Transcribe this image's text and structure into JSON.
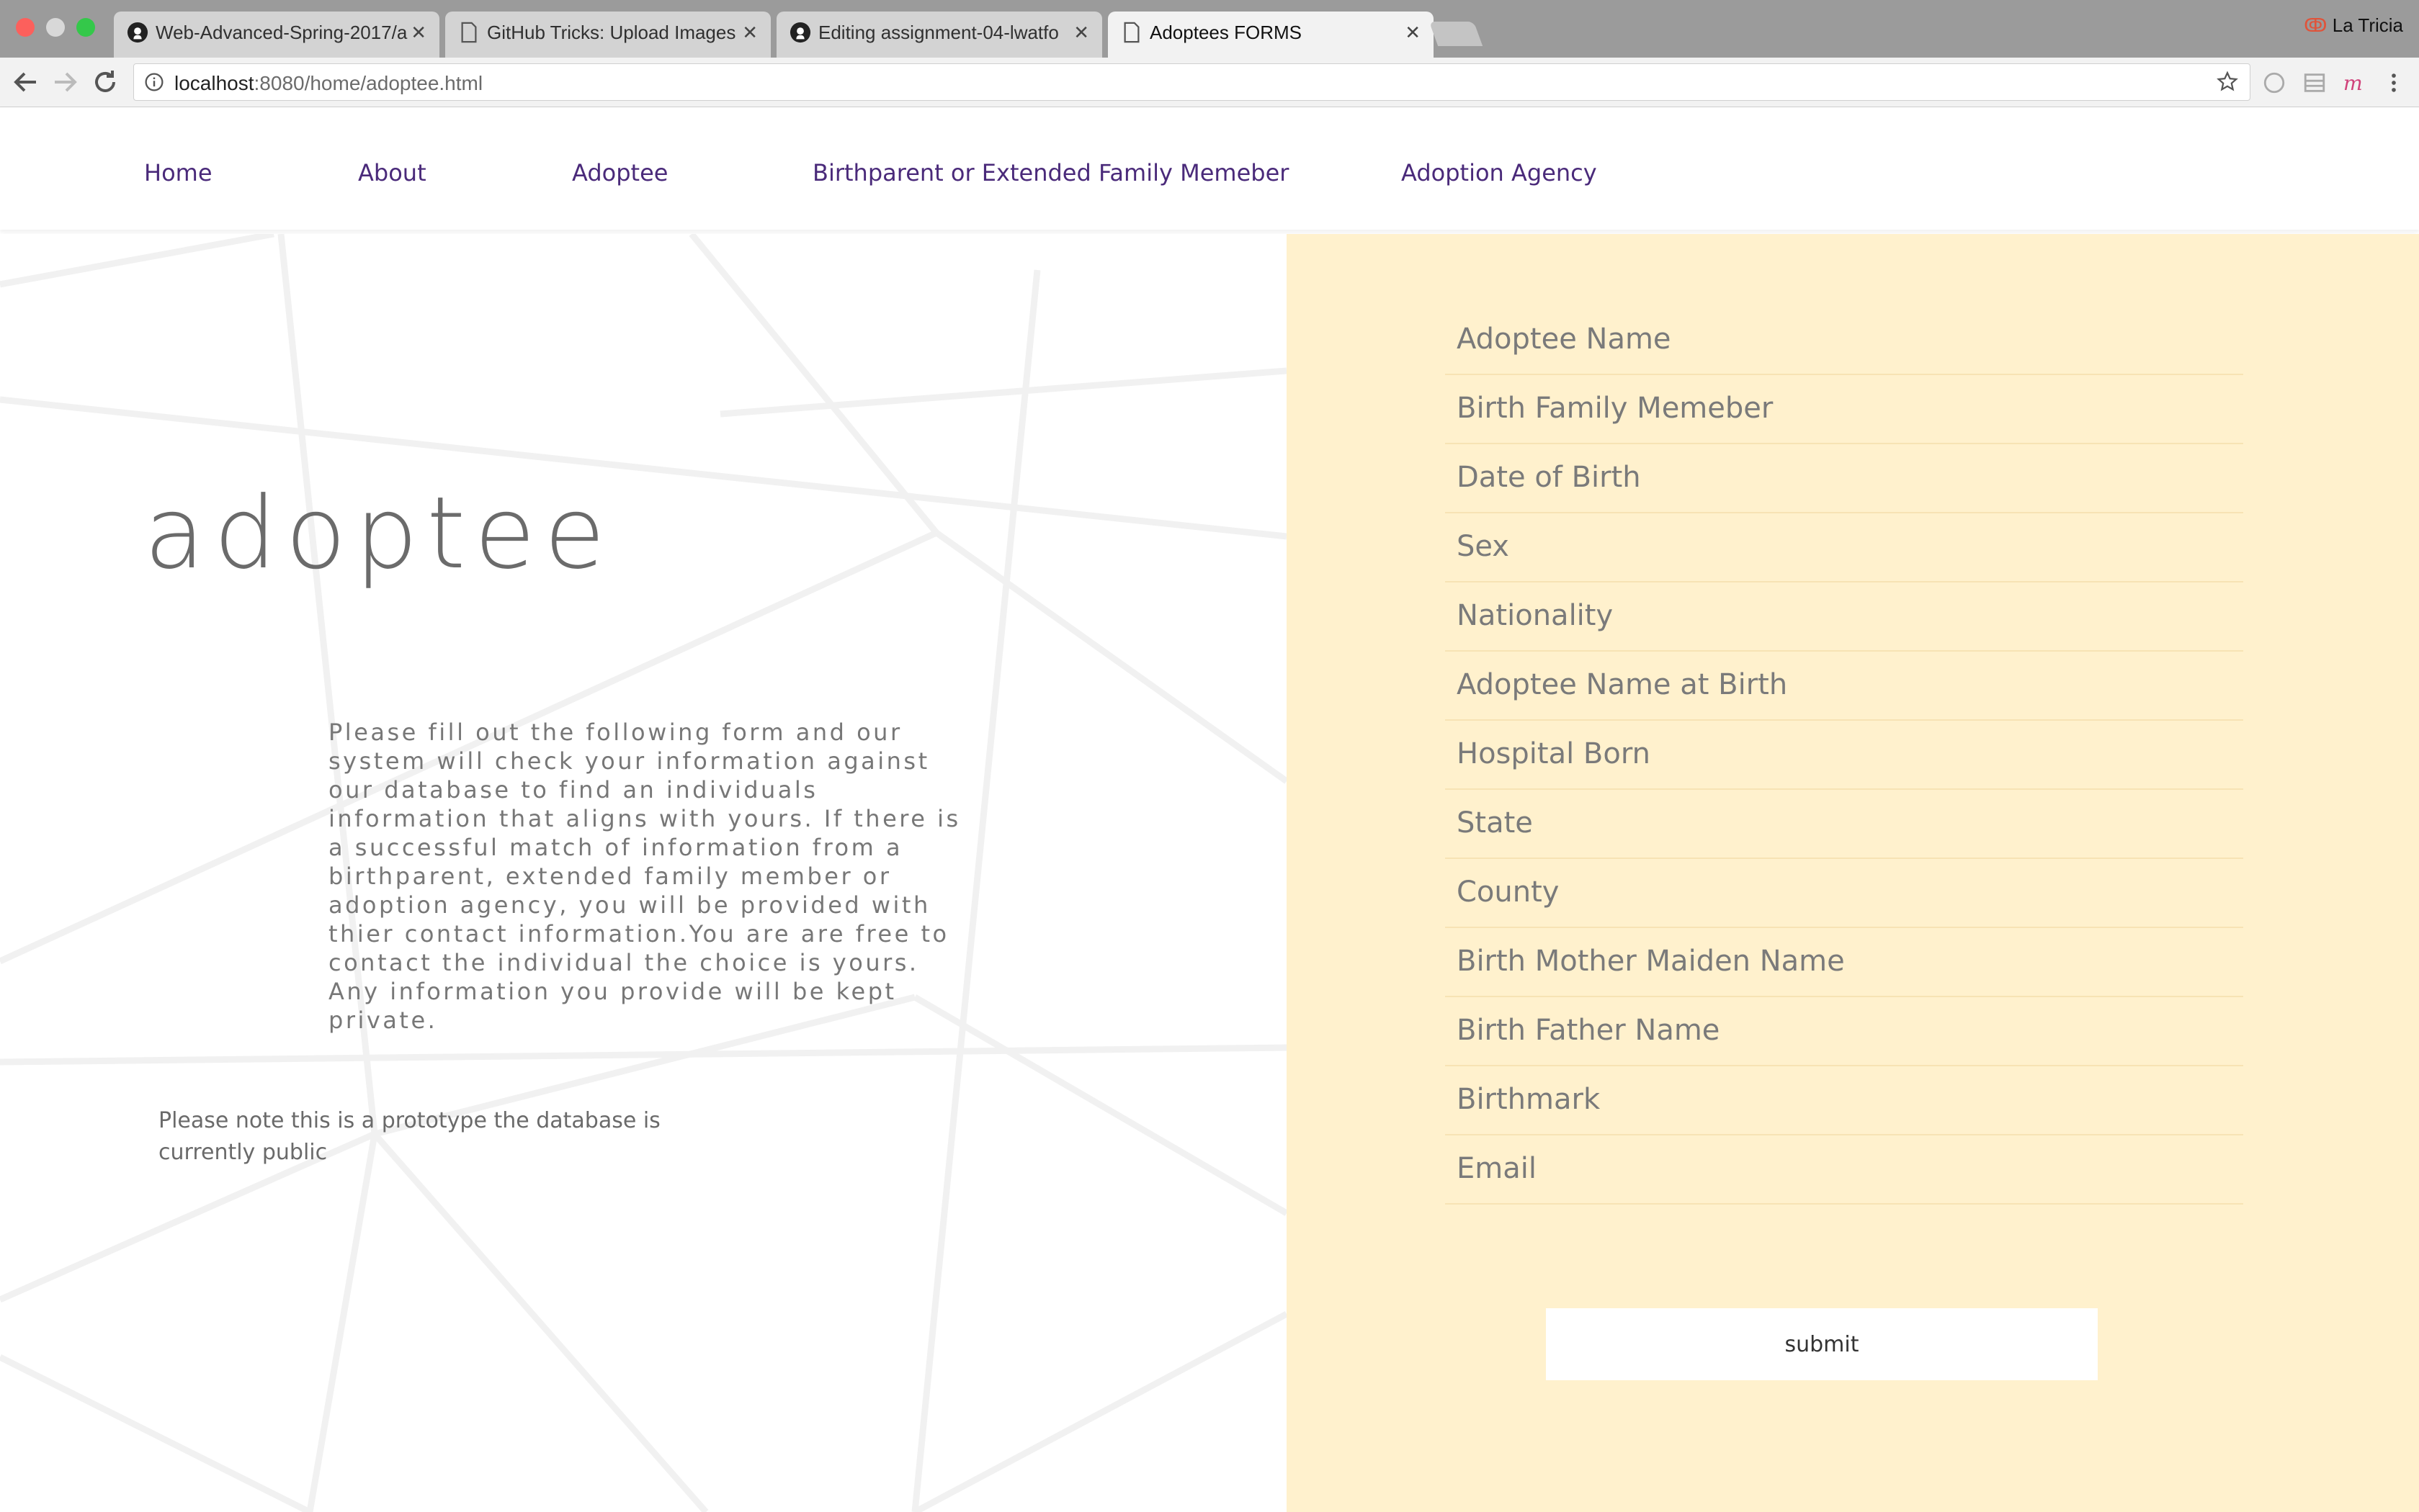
{
  "browser": {
    "tabs": [
      {
        "title": "Web-Advanced-Spring-2017/a",
        "icon": "github-icon",
        "active": false
      },
      {
        "title": "GitHub Tricks: Upload Images",
        "icon": "document-icon",
        "active": false
      },
      {
        "title": "Editing assignment-04-lwatfo",
        "icon": "github-icon",
        "active": false
      },
      {
        "title": "Adoptees FORMS",
        "icon": "document-icon",
        "active": true
      }
    ],
    "profile_name": "La Tricia",
    "url_host": "localhost",
    "url_rest": ":8080/home/adoptee.html"
  },
  "nav": {
    "items": [
      "Home",
      "About",
      "Adoptee",
      "Birthparent or Extended Family Memeber",
      "Adoption Agency"
    ]
  },
  "page": {
    "heading": "adoptee",
    "intro": "Please fill out the following form and our system will check your information against our database to find an individuals information that aligns with yours. If there is a successful match of information from a birthparent, extended family member or adoption agency, you will be provided with thier contact information.You are are free to contact the individual the choice is yours. Any information you provide will be kept private.",
    "note": "Please note this is a prototype the database is currently public"
  },
  "form": {
    "fields": [
      {
        "placeholder": "Adoptee Name",
        "value": ""
      },
      {
        "placeholder": "Birth Family Memeber",
        "value": ""
      },
      {
        "placeholder": "Date of Birth",
        "value": ""
      },
      {
        "placeholder": "Sex",
        "value": ""
      },
      {
        "placeholder": "Nationality",
        "value": ""
      },
      {
        "placeholder": "Adoptee Name at Birth",
        "value": ""
      },
      {
        "placeholder": "Hospital Born",
        "value": ""
      },
      {
        "placeholder": "State",
        "value": ""
      },
      {
        "placeholder": "County",
        "value": ""
      },
      {
        "placeholder": "Birth Mother Maiden Name",
        "value": ""
      },
      {
        "placeholder": "Birth Father Name",
        "value": ""
      },
      {
        "placeholder": "Birthmark",
        "value": ""
      },
      {
        "placeholder": "Email",
        "value": ""
      }
    ],
    "submit_label": "submit"
  },
  "colors": {
    "form_panel": "#fff1cd",
    "nav_link": "#4a2a7a",
    "heading": "#6b6b6b"
  }
}
